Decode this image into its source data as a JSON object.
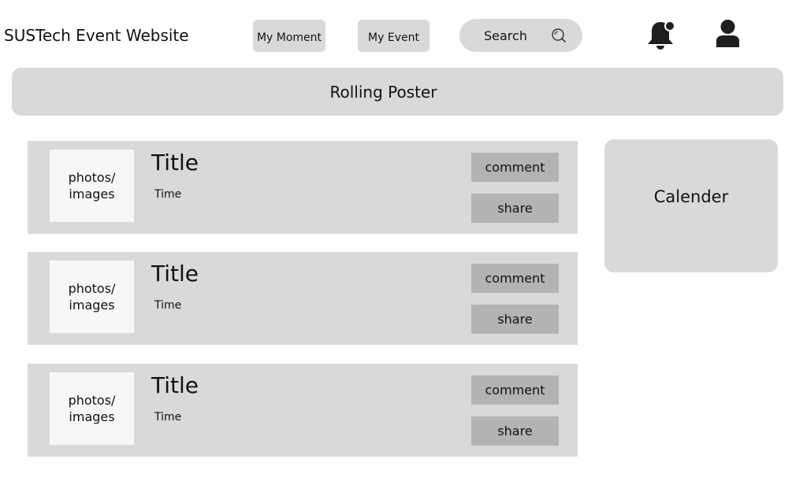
{
  "header": {
    "site_title": "SUSTech Event Website",
    "nav": {
      "my_moment": "My Moment",
      "my_event": "My Event"
    },
    "search": {
      "label": "Search",
      "icon": "search-icon"
    },
    "icons": {
      "notifications": "bell-icon",
      "profile": "user-icon"
    }
  },
  "poster": {
    "label": "Rolling Poster"
  },
  "events": [
    {
      "image_label_line1": "photos/",
      "image_label_line2": "images",
      "title": "Title",
      "time": "Time",
      "comment_label": "comment",
      "share_label": "share"
    },
    {
      "image_label_line1": "photos/",
      "image_label_line2": "images",
      "title": "Title",
      "time": "Time",
      "comment_label": "comment",
      "share_label": "share"
    },
    {
      "image_label_line1": "photos/",
      "image_label_line2": "images",
      "title": "Title",
      "time": "Time",
      "comment_label": "comment",
      "share_label": "share"
    }
  ],
  "calendar": {
    "label": "Calender"
  },
  "colors": {
    "panel": "#d9d9d9",
    "button": "#b3b3b3",
    "image_placeholder": "#f7f7f7",
    "icon": "#1e1e1e"
  }
}
